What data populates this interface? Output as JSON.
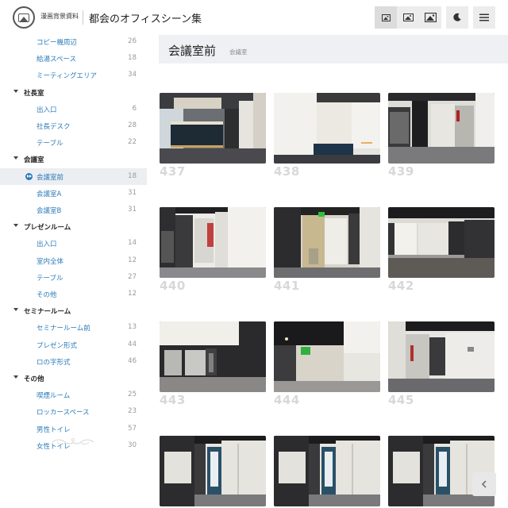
{
  "header": {
    "site_name": "漫画背景資料",
    "title": "都会のオフィスシーン集",
    "buttons": [
      {
        "name": "gallery-small-button",
        "icon": "image-small-icon",
        "active": true
      },
      {
        "name": "gallery-medium-button",
        "icon": "image-medium-icon",
        "active": false
      },
      {
        "name": "gallery-large-button",
        "icon": "image-large-icon",
        "active": false
      },
      {
        "name": "dark-mode-button",
        "icon": "moon-icon",
        "active": false
      },
      {
        "name": "menu-button",
        "icon": "hamburger-icon",
        "active": false
      }
    ]
  },
  "sidebar": {
    "groups": [
      {
        "label": null,
        "items": [
          {
            "label": "コピー機周辺",
            "count": "26"
          },
          {
            "label": "給湯スペース",
            "count": "18"
          },
          {
            "label": "ミーティングエリア",
            "count": "34"
          }
        ]
      },
      {
        "label": "社長室",
        "items": [
          {
            "label": "出入口",
            "count": "6"
          },
          {
            "label": "社長デスク",
            "count": "28"
          },
          {
            "label": "テーブル",
            "count": "22"
          }
        ]
      },
      {
        "label": "会議室",
        "items": [
          {
            "label": "会議室前",
            "count": "18",
            "selected": true
          },
          {
            "label": "会議室A",
            "count": "31"
          },
          {
            "label": "会議室B",
            "count": "31"
          }
        ]
      },
      {
        "label": "プレゼンルーム",
        "items": [
          {
            "label": "出入口",
            "count": "14"
          },
          {
            "label": "室内全体",
            "count": "12"
          },
          {
            "label": "テーブル",
            "count": "27"
          },
          {
            "label": "その他",
            "count": "12"
          }
        ]
      },
      {
        "label": "セミナールーム",
        "items": [
          {
            "label": "セミナールーム前",
            "count": "13"
          },
          {
            "label": "プレゼン形式",
            "count": "44"
          },
          {
            "label": "ロの字形式",
            "count": "46"
          }
        ]
      },
      {
        "label": "その他",
        "items": [
          {
            "label": "喫煙ルーム",
            "count": "25"
          },
          {
            "label": "ロッカースペース",
            "count": "23"
          },
          {
            "label": "男性トイレ",
            "count": "57"
          },
          {
            "label": "女性トイレ",
            "count": "30"
          }
        ]
      }
    ]
  },
  "main": {
    "section_title": "会議室前",
    "section_subtitle": "会議室",
    "images": [
      {
        "number": "437",
        "scene": "reception"
      },
      {
        "number": "438",
        "scene": "lobby-wall"
      },
      {
        "number": "439",
        "scene": "corridor-right"
      },
      {
        "number": "440",
        "scene": "corridor-center"
      },
      {
        "number": "441",
        "scene": "corridor-door"
      },
      {
        "number": "442",
        "scene": "glass-wall"
      },
      {
        "number": "443",
        "scene": "glass-partition"
      },
      {
        "number": "444",
        "scene": "exit-sign"
      },
      {
        "number": "445",
        "scene": "corridor-panels"
      },
      {
        "number": "",
        "scene": "corridor-long"
      },
      {
        "number": "",
        "scene": "corridor-long"
      },
      {
        "number": "",
        "scene": "corridor-long"
      }
    ]
  },
  "colors": {
    "link": "#2a7ab8",
    "count": "#999999",
    "section_bar": "#eef0f3",
    "image_number": "#d8d8d8"
  },
  "back_button": {
    "icon": "chevron-left-icon"
  }
}
